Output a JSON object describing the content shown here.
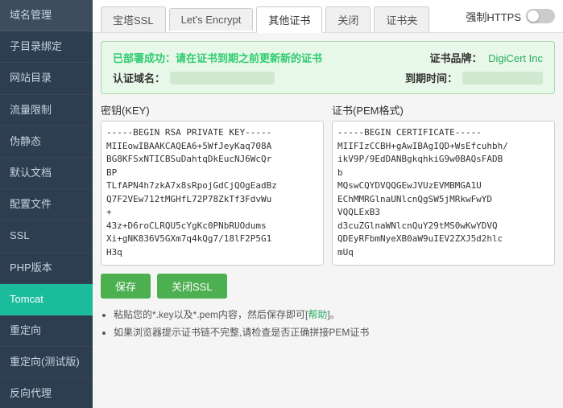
{
  "sidebar": {
    "items": [
      {
        "label": "域名管理",
        "id": "domain-manage",
        "active": false
      },
      {
        "label": "子目录绑定",
        "id": "subdir-bind",
        "active": false
      },
      {
        "label": "网站目录",
        "id": "website-dir",
        "active": false
      },
      {
        "label": "流量限制",
        "id": "traffic-limit",
        "active": false
      },
      {
        "label": "伪静态",
        "id": "pseudo-static",
        "active": false
      },
      {
        "label": "默认文档",
        "id": "default-doc",
        "active": false
      },
      {
        "label": "配置文件",
        "id": "config-file",
        "active": false
      },
      {
        "label": "SSL",
        "id": "ssl",
        "active": false
      },
      {
        "label": "PHP版本",
        "id": "php-version",
        "active": false
      },
      {
        "label": "Tomcat",
        "id": "tomcat",
        "active": false
      },
      {
        "label": "重定向",
        "id": "redirect",
        "active": false
      },
      {
        "label": "重定向(测试版)",
        "id": "redirect-beta",
        "active": false
      },
      {
        "label": "反向代理",
        "id": "reverse-proxy",
        "active": false
      }
    ]
  },
  "tabs": [
    {
      "label": "宝塔SSL",
      "id": "baota-ssl",
      "active": false
    },
    {
      "label": "Let's Encrypt",
      "id": "lets-encrypt",
      "active": false
    },
    {
      "label": "其他证书",
      "id": "other-cert",
      "active": true
    },
    {
      "label": "关闭",
      "id": "close-ssl-tab",
      "active": false
    },
    {
      "label": "证书夹",
      "id": "cert-folder",
      "active": false
    }
  ],
  "force_https": {
    "label": "强制HTTPS"
  },
  "success_banner": {
    "title": "已部署成功：请在证书到期之前更新新的证书",
    "domain_label": "认证域名：",
    "brand_label": "证书品牌：",
    "brand_value": "DigiCert Inc",
    "expiry_label": "到期时间："
  },
  "key_section": {
    "label": "密钥(KEY)",
    "content": "-----BEGIN RSA PRIVATE KEY-----\nMIIEowIBAAKCAQEA6+5WfJeyKaq708A\nBG8KFSxNTICBSuDahtqDkEucNJ6WcQr\nBP\nTLfAPN4h7zkA7x8sRpojGdCjQOgEadBz\nQ7F2VEw712tMGHfL72P78ZkTf3FdvWu\n+\n43z+D6roCLRQU5cYgKc0PNbRUOdums\nXi+gNK836V5GXm7q4kQg7/18lF2P5G1\nH3q"
  },
  "cert_section": {
    "label": "证书(PEM格式)",
    "content": "-----BEGIN CERTIFICATE-----\nMIIFIzCCBH+gAwIBAgIQD+WsEfcuhbh/\nikV9P/9EdDANBgkqhkiG9w0BAQsFADB\nb\nMQswCQYDVQQGEwJVUzEVMBMGA1U\nEChMMRGlnaUNlcnQgSW5jMRkwFwYD\nVQQLExB3\nd3cuZGlnaWNlcnQuY29tMS0wKwYDVQ\nQDEyRFbmNyeXB0aW9uIEV2ZXJ5d2hlc\nmUq"
  },
  "buttons": {
    "save": "保存",
    "close_ssl": "关闭SSL"
  },
  "tips": [
    {
      "text": "粘贴您的*.key以及*.pem内容，然后保存即可[帮助]。",
      "link": "帮助"
    },
    {
      "text": "如果浏览器提示证书链不完整,请检查是否正确拼接PEM证书"
    }
  ]
}
